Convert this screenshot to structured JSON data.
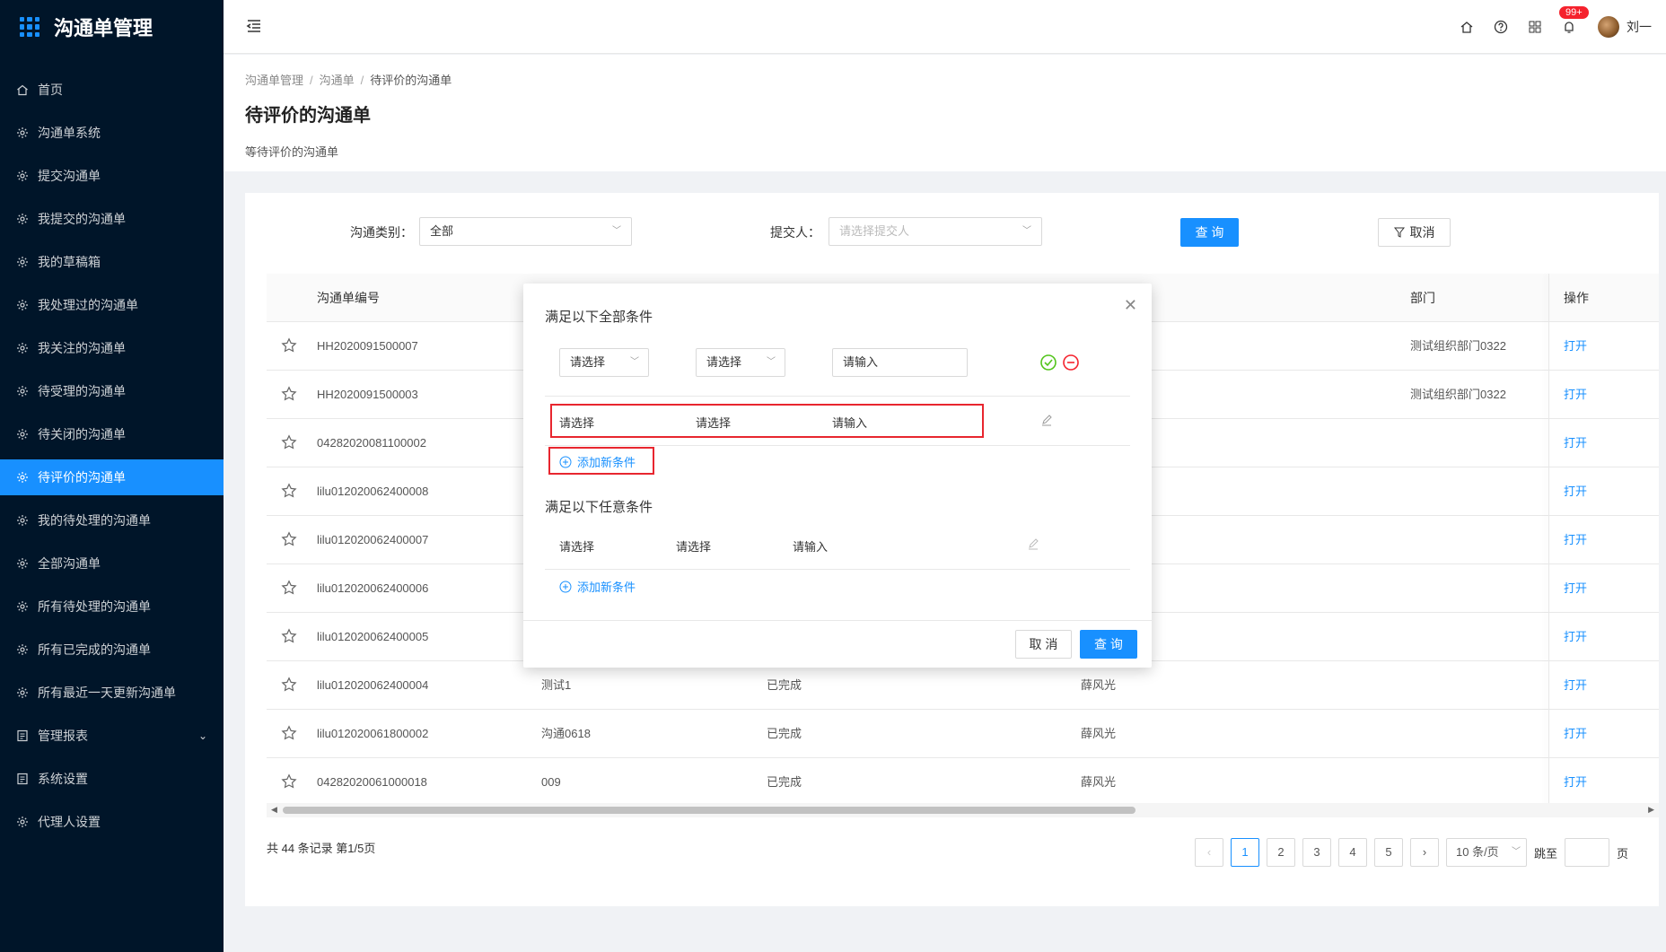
{
  "app": {
    "title": "沟通单管理"
  },
  "sidebar": {
    "items": [
      {
        "label": "首页",
        "icon": "home-icon"
      },
      {
        "label": "沟通单系统",
        "icon": "gear-icon"
      },
      {
        "label": "提交沟通单",
        "icon": "gear-icon"
      },
      {
        "label": "我提交的沟通单",
        "icon": "gear-icon"
      },
      {
        "label": "我的草稿箱",
        "icon": "gear-icon"
      },
      {
        "label": "我处理过的沟通单",
        "icon": "gear-icon"
      },
      {
        "label": "我关注的沟通单",
        "icon": "gear-icon"
      },
      {
        "label": "待受理的沟通单",
        "icon": "gear-icon"
      },
      {
        "label": "待关闭的沟通单",
        "icon": "gear-icon"
      },
      {
        "label": "待评价的沟通单",
        "icon": "gear-icon",
        "active": true
      },
      {
        "label": "我的待处理的沟通单",
        "icon": "gear-icon"
      },
      {
        "label": "全部沟通单",
        "icon": "gear-icon"
      },
      {
        "label": "所有待处理的沟通单",
        "icon": "gear-icon"
      },
      {
        "label": "所有已完成的沟通单",
        "icon": "gear-icon"
      },
      {
        "label": "所有最近一天更新沟通单",
        "icon": "gear-icon"
      },
      {
        "label": "管理报表",
        "icon": "report-icon",
        "expandable": true
      },
      {
        "label": "系统设置",
        "icon": "report-icon"
      },
      {
        "label": "代理人设置",
        "icon": "gear-icon"
      }
    ]
  },
  "header": {
    "notification_badge": "99+",
    "username": "刘一"
  },
  "page": {
    "breadcrumb": [
      "沟通单管理",
      "沟通单",
      "待评价的沟通单"
    ],
    "title": "待评价的沟通单",
    "description": "等待评价的沟通单"
  },
  "filters": {
    "category_label": "沟通类别：",
    "category_value": "全部",
    "submitter_label": "提交人：",
    "submitter_placeholder": "请选择提交人",
    "query_button": "查 询",
    "cancel_button": "取消"
  },
  "table": {
    "columns": {
      "id": "沟通单编号",
      "dept": "部门",
      "op": "操作"
    },
    "rows": [
      {
        "id": "HH2020091500007",
        "title": "",
        "status": "",
        "person": "",
        "dept": "测试组织部门0322",
        "op": "打开"
      },
      {
        "id": "HH2020091500003",
        "title": "",
        "status": "",
        "person": "",
        "dept": "测试组织部门0322",
        "op": "打开"
      },
      {
        "id": "04282020081100002",
        "title": "",
        "status": "",
        "person": "",
        "dept": "",
        "op": "打开"
      },
      {
        "id": "lilu012020062400008",
        "title": "",
        "status": "",
        "person": "",
        "dept": "",
        "op": "打开"
      },
      {
        "id": "lilu012020062400007",
        "title": "",
        "status": "",
        "person": "",
        "dept": "",
        "op": "打开"
      },
      {
        "id": "lilu012020062400006",
        "title": "",
        "status": "",
        "person": "",
        "dept": "",
        "op": "打开"
      },
      {
        "id": "lilu012020062400005",
        "title": "",
        "status": "",
        "person": "",
        "dept": "",
        "op": "打开"
      },
      {
        "id": "lilu012020062400004",
        "title": "测试1",
        "status": "已完成",
        "person": "薛风光",
        "dept": "",
        "op": "打开"
      },
      {
        "id": "lilu012020061800002",
        "title": "沟通0618",
        "status": "已完成",
        "person": "薛风光",
        "dept": "",
        "op": "打开"
      },
      {
        "id": "04282020061000018",
        "title": "009",
        "status": "已完成",
        "person": "薛风光",
        "dept": "",
        "op": "打开"
      }
    ]
  },
  "pagination": {
    "summary": "共 44 条记录 第1/5页",
    "pages": [
      "1",
      "2",
      "3",
      "4",
      "5"
    ],
    "current": "1",
    "page_size": "10 条/页",
    "jump_label": "跳至",
    "page_suffix": "页"
  },
  "modal": {
    "all_title": "满足以下全部条件",
    "any_title": "满足以下任意条件",
    "select_placeholder": "请选择",
    "input_placeholder": "请输入",
    "add_condition": "添加新条件",
    "cancel": "取 消",
    "query": "查 询"
  },
  "colors": {
    "primary": "#1890ff",
    "sidebar": "#001529",
    "highlight": "#e8262f"
  }
}
